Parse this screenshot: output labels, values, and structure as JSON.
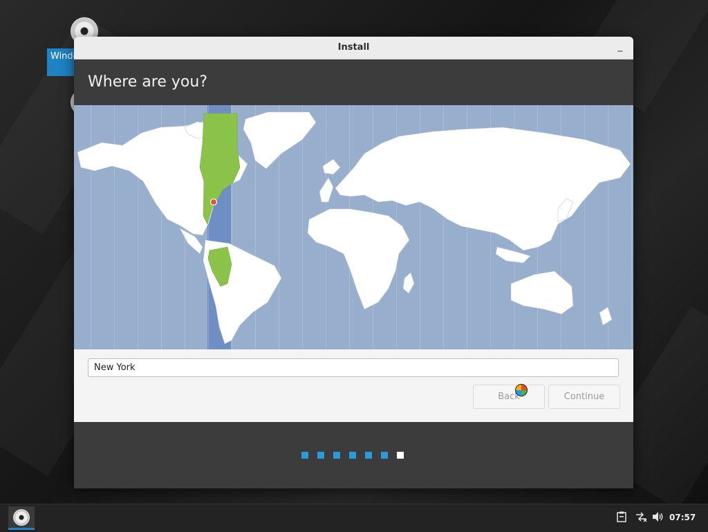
{
  "window": {
    "title": "Install",
    "minimize_glyph": "_"
  },
  "page": {
    "heading": "Where are you?"
  },
  "location": {
    "city_value": "New York",
    "placeholder": ""
  },
  "buttons": {
    "back": "Back",
    "continue": "Continue"
  },
  "progress": {
    "total_steps": 7,
    "current_step": 7
  },
  "desktop": {
    "icon_label": "Windo"
  },
  "taskbar": {
    "clock": "07:57"
  },
  "icons": [
    "disc-icon",
    "minimize-icon",
    "clipboard-icon",
    "network-disconnected-icon",
    "volume-icon",
    "busy-spinner-icon"
  ],
  "colors": {
    "accent": "#2b9ad8",
    "ocean": "#98aecd",
    "timezone_band": "#6f8fc4",
    "highlight_land": "#8bc34a",
    "land": "#ffffff"
  }
}
